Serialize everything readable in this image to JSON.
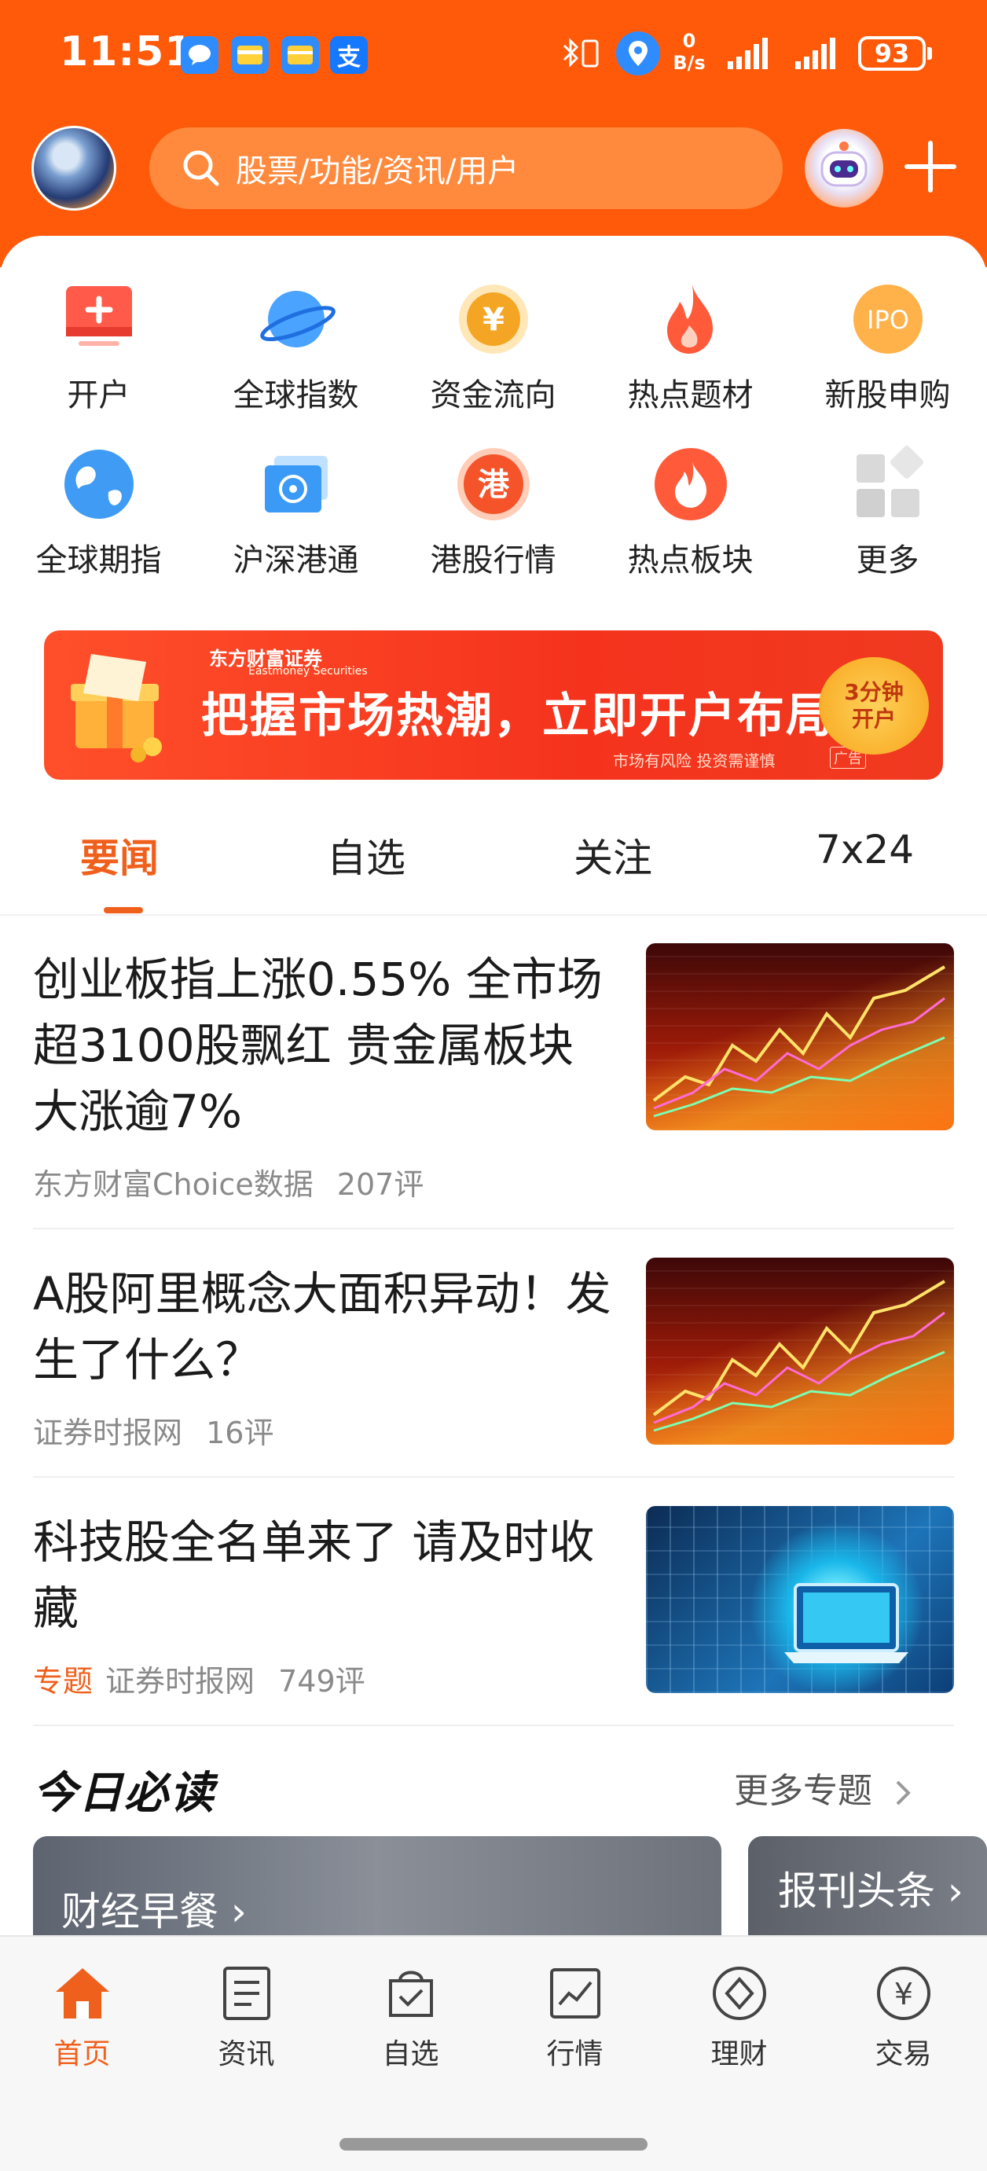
{
  "status_bar": {
    "time": "11:51",
    "net_speed_top": "0",
    "net_speed_unit": "B/s",
    "battery": "93"
  },
  "header": {
    "search_placeholder": "股票/功能/资讯/用户"
  },
  "quick_grid": [
    {
      "label": "开户",
      "icon": "open-account-icon"
    },
    {
      "label": "全球指数",
      "icon": "planet-icon"
    },
    {
      "label": "资金流向",
      "icon": "yuan-coin-icon"
    },
    {
      "label": "热点题材",
      "icon": "flame-icon"
    },
    {
      "label": "新股申购",
      "icon": "ipo-icon",
      "icon_text": "IPO"
    },
    {
      "label": "全球期指",
      "icon": "globe-icon"
    },
    {
      "label": "沪深港通",
      "icon": "hk-flag-icon"
    },
    {
      "label": "港股行情",
      "icon": "hk-stock-icon",
      "icon_text": "港"
    },
    {
      "label": "热点板块",
      "icon": "flame-circle-icon"
    },
    {
      "label": "更多",
      "icon": "more-grid-icon"
    }
  ],
  "banner": {
    "brand": "东方财富证券",
    "brand_en": "Eastmoney Securities",
    "headline": "把握市场热潮，立即开户布局",
    "risk_note": "市场有风险 投资需谨慎",
    "ad_tag": "广告",
    "badge_line1": "3分钟",
    "badge_line2": "开户"
  },
  "tabs": [
    "要闻",
    "自选",
    "关注",
    "7x24"
  ],
  "news": [
    {
      "title": "创业板指上涨0.55% 全市场超3100股飘红 贵金属板块大涨逾7%",
      "tag": "",
      "source": "东方财富Choice数据",
      "comments": "207评"
    },
    {
      "title": "A股阿里概念大面积异动！发生了什么？",
      "tag": "",
      "source": "证券时报网",
      "comments": "16评"
    },
    {
      "title": "科技股全名单来了 请及时收藏",
      "tag": "专题",
      "source": "证券时报网",
      "comments": "749评"
    }
  ],
  "today": {
    "title": "今日必读",
    "more": "更多专题",
    "cards": [
      "财经早餐",
      "报刊头条"
    ]
  },
  "bottom_nav": [
    {
      "label": "首页",
      "icon": "home-icon"
    },
    {
      "label": "资讯",
      "icon": "news-icon"
    },
    {
      "label": "自选",
      "icon": "watchlist-icon"
    },
    {
      "label": "行情",
      "icon": "market-icon"
    },
    {
      "label": "理财",
      "icon": "wealth-icon"
    },
    {
      "label": "交易",
      "icon": "trade-icon"
    }
  ],
  "colors": {
    "brand_orange": "#ff5a0a",
    "accent": "#f0601d"
  }
}
